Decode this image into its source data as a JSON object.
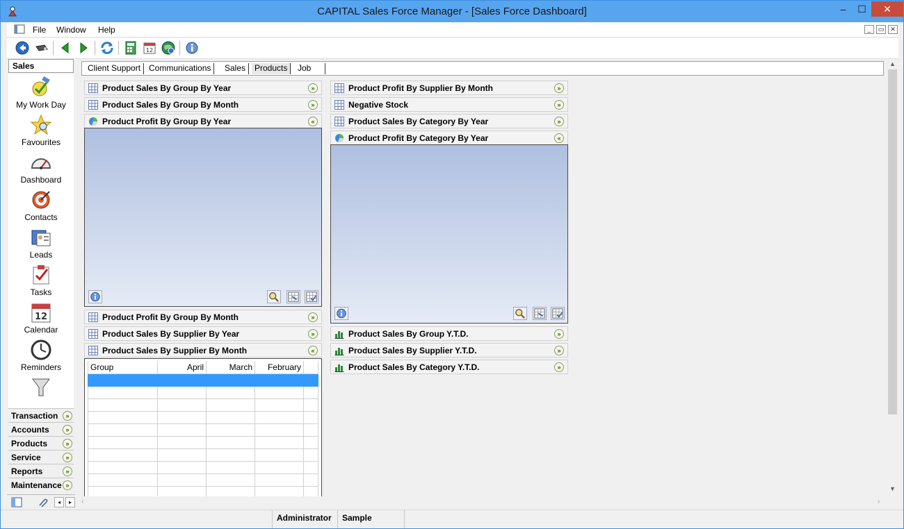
{
  "window": {
    "title": "CAPITAL Sales Force Manager - [Sales Force Dashboard]",
    "minimize": "–",
    "maximize": "☐",
    "close": "✕"
  },
  "menu": {
    "items": [
      "File",
      "Window",
      "Help"
    ],
    "mdi": [
      "_",
      "▭",
      "✕"
    ]
  },
  "toolbar": {
    "icons": [
      "back-icon",
      "remote-icon",
      "previous-icon",
      "next-icon",
      "refresh-icon",
      "calculator-icon",
      "calendar-icon",
      "web-icon",
      "info-icon"
    ]
  },
  "sidebar": {
    "header": "Sales",
    "items": [
      {
        "label": "My Work Day",
        "icon": "workday-icon"
      },
      {
        "label": "Favourites",
        "icon": "star-icon"
      },
      {
        "label": "Dashboard",
        "icon": "gauge-icon"
      },
      {
        "label": "Contacts",
        "icon": "target-icon"
      },
      {
        "label": "Leads",
        "icon": "leads-icon"
      },
      {
        "label": "Tasks",
        "icon": "tasks-icon"
      },
      {
        "label": "Calendar",
        "icon": "calendar-icon",
        "day": "12"
      },
      {
        "label": "Reminders",
        "icon": "clock-icon"
      }
    ],
    "more": "▾",
    "groups": [
      "Transaction",
      "Accounts",
      "Products",
      "Service",
      "Reports",
      "Maintenance"
    ]
  },
  "tabs": [
    "Client Support",
    "Communications",
    "Sales",
    "Products",
    "Job"
  ],
  "active_tab": "Products",
  "widgets_left": [
    {
      "title": "Product Sales By Group By Year",
      "type": "grid",
      "expanded": false
    },
    {
      "title": "Product Sales By Group By Month",
      "type": "grid",
      "expanded": false
    },
    {
      "title": "Product Profit By Group By Year",
      "type": "pie",
      "expanded": true
    },
    {
      "title": "Product Profit By Group By Month",
      "type": "grid",
      "expanded": false
    },
    {
      "title": "Product Sales By Supplier By Year",
      "type": "grid",
      "expanded": false
    },
    {
      "title": "Product Sales By Supplier By Month",
      "type": "grid",
      "expanded": true
    }
  ],
  "widgets_right": [
    {
      "title": "Product Profit By Supplier By Month",
      "type": "grid",
      "expanded": false
    },
    {
      "title": "Negative Stock",
      "type": "grid",
      "expanded": false
    },
    {
      "title": "Product Sales By Category By Year",
      "type": "grid",
      "expanded": false
    },
    {
      "title": "Product Profit By Category By Year",
      "type": "pie",
      "expanded": true
    },
    {
      "title": "Product Sales By Group Y.T.D.",
      "type": "bar",
      "expanded": false
    },
    {
      "title": "Product Sales By Supplier Y.T.D.",
      "type": "bar",
      "expanded": false
    },
    {
      "title": "Product Sales By Category Y.T.D.",
      "type": "bar",
      "expanded": false
    }
  ],
  "supplier_grid": {
    "columns": [
      "Group",
      "April",
      "March",
      "February"
    ]
  },
  "chevrons": {
    "down": "»",
    "up": "«"
  },
  "status": {
    "user": "Administrator",
    "database": "Sample"
  },
  "colors": {
    "titlebar": "#57a5ef",
    "close": "#c74c3c",
    "selection": "#3399ff",
    "chart_top": "#aebfe0",
    "chart_bottom": "#e5ebf6"
  }
}
